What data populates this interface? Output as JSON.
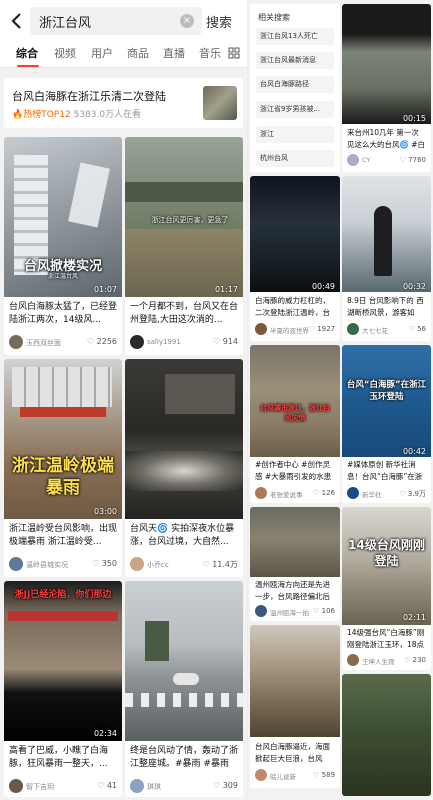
{
  "header": {
    "query": "浙江台风",
    "clear_glyph": "×",
    "search_label": "搜索",
    "tabs": [
      "综合",
      "视频",
      "用户",
      "商品",
      "直播",
      "音乐"
    ]
  },
  "hot": {
    "title": "台风白海豚在浙江乐清二次登陆",
    "badge": "热榜TOP12",
    "views": "5383.0万人在看"
  },
  "left_cards": [
    {
      "duration": "01:07",
      "overlay": "台风掀楼实况",
      "overlay_sub": "浙江温台风",
      "caption": "台风白海豚太猛了，已经登陆浙江两次，14级风...",
      "user": "玉西双丝面",
      "likes": "2256"
    },
    {
      "duration": "01:17",
      "overlay": "浙江台风更厉害，更急了",
      "caption": "一个月都不到，台风又在台州登陆,大田这次淌的...",
      "user": "sally1991",
      "likes": "914"
    },
    {
      "duration": "03:00",
      "overlay": "浙江温岭极端暴雨",
      "caption": "浙江温岭受台风影响，出现极端暴雨 浙江温岭受...",
      "user": "温岭县城实况",
      "likes": "350"
    },
    {
      "duration": "",
      "overlay": "",
      "caption": "台风天🌀 实拍深夜水位暴涨，台风过境，大自然...",
      "user": "小乔cc",
      "likes": "11.4万"
    },
    {
      "duration": "02:34",
      "overlay": "浙JJ已经沦陷，你们那边",
      "caption": "高看了巴威，小瞧了白海豚，狂风暴雨一整天，...",
      "user": "智下吉玥",
      "likes": "41"
    },
    {
      "duration": "",
      "overlay": "",
      "caption": "终是台风动了情，轰动了浙江整座城。#暴雨 #暴雨",
      "user": "琪琪",
      "likes": "309"
    }
  ],
  "related": {
    "title": "相关搜索",
    "items": [
      "浙江台风13人死亡",
      "浙江台风最新消息",
      "台风白海豚路径",
      "浙江省9岁男孩被...",
      "浙江",
      "杭州台风"
    ]
  },
  "right_cards": [
    {
      "duration": "00:15",
      "overlay": "",
      "caption": "来台州10几年 第一次见这么大的台风🌀 #白海豚",
      "user": "CY",
      "likes": "7760"
    },
    {
      "duration": "00:49",
      "overlay": "",
      "caption": "白海豚的威力杠杠的，二次登陆浙江温岭，台州...",
      "user": "半夏的夜世界",
      "likes": "1927"
    },
    {
      "duration": "00:32",
      "overlay": "",
      "caption": "8.9日 台风影响下的 西湖断桥风景，游客如织...",
      "user": "大七七花",
      "likes": "56"
    },
    {
      "duration": "",
      "overlay": "台风袭击浙江，浙江台风灾情",
      "caption": "#创作者中心 #创作灵感 #大暴雨引发的水患大...",
      "user": "老张爱说事",
      "likes": "126"
    },
    {
      "duration": "00:42",
      "overlay": "台风“白海豚”在浙江玉环登陆",
      "caption": "#媒体原创 新华社消息！台风“白海豚”在浙江玉...",
      "user": "新华社",
      "likes": "3.9万"
    },
    {
      "duration": "",
      "overlay": "",
      "caption": "温州瓯海方向还是先进一步，台风路径偏北后登...",
      "user": "温州瓯海一拍",
      "likes": "106"
    },
    {
      "duration": "02:11",
      "overlay": "14级台风刚刚登陆",
      "caption": "14级强台风“白海豚”刚刚登陆浙江玉环，18点40...",
      "user": "王坤人生观",
      "likes": "230"
    },
    {
      "duration": "",
      "overlay": "",
      "caption": "台风白海豚逼近，海面掀起巨大巨浪，台风天，...",
      "user": "皖儿说新",
      "likes": "589"
    },
    {
      "duration": "",
      "overlay": "",
      "caption": "",
      "user": "",
      "likes": ""
    }
  ],
  "colors": {
    "accent": "#ff3b30",
    "hot_badge": "#ff6a00"
  }
}
